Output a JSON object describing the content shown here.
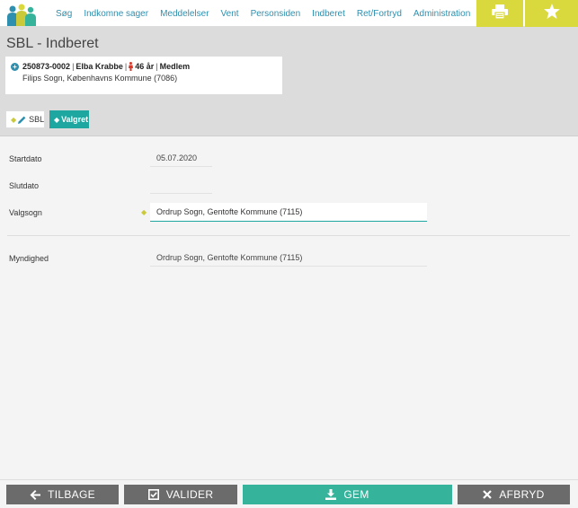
{
  "nav": {
    "items": [
      "Søg",
      "Indkomne sager",
      "Meddelelser",
      "Vent",
      "Personsiden",
      "Indberet",
      "Ret/Fortryd",
      "Administration"
    ]
  },
  "page": {
    "title": "SBL - Indberet"
  },
  "person": {
    "id": "250873-0002",
    "name": "Elba Krabbe",
    "age": "46 år",
    "status": "Medlem",
    "address": "Filips Sogn, Københavns Kommune (7086)"
  },
  "chips": {
    "sbl": "SBL",
    "valgret": "Valgret"
  },
  "form": {
    "startdato_label": "Startdato",
    "startdato_value": "05.07.2020",
    "slutdato_label": "Slutdato",
    "slutdato_value": "",
    "valgsogn_label": "Valgsogn",
    "valgsogn_value": "Ordrup Sogn, Gentofte Kommune (7115)",
    "myndighed_label": "Myndighed",
    "myndighed_value": "Ordrup Sogn, Gentofte Kommune (7115)"
  },
  "actions": {
    "back": "TILBAGE",
    "validate": "VALIDER",
    "save": "GEM",
    "cancel": "AFBRYD"
  },
  "colors": {
    "link": "#2f8fae",
    "accent_yellow": "#d9d93e",
    "teal": "#1ea7a0",
    "save_green": "#36b39b",
    "button_gray": "#6b6b6b"
  },
  "icons": {
    "logo": "people-logo-icon",
    "print": "printer-icon",
    "favorite": "star-icon"
  }
}
